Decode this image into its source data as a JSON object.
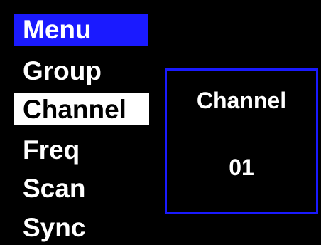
{
  "colors": {
    "background": "#000000",
    "accent": "#1a1aff",
    "text": "#ffffff",
    "selected_bg": "#ffffff",
    "selected_text": "#000000"
  },
  "menu": {
    "title": "Menu",
    "items": [
      {
        "label": "Group",
        "selected": false
      },
      {
        "label": "Channel",
        "selected": true
      },
      {
        "label": "Freq",
        "selected": false
      },
      {
        "label": "Scan",
        "selected": false
      },
      {
        "label": "Sync",
        "selected": false
      }
    ]
  },
  "panel": {
    "label": "Channel",
    "value": "01"
  }
}
